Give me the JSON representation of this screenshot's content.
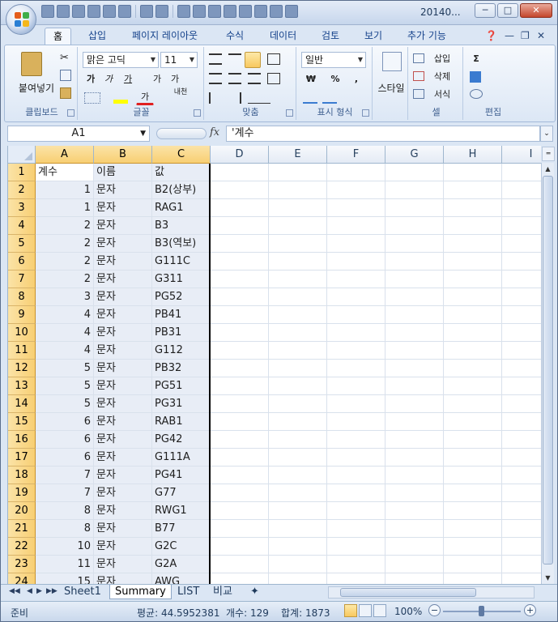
{
  "window": {
    "title": "20140...",
    "controls": [
      "─",
      "□",
      "✕"
    ]
  },
  "ribbon": {
    "tabs": [
      "홈",
      "삽입",
      "페이지 레이아웃",
      "수식",
      "데이터",
      "검토",
      "보기",
      "추가 기능"
    ],
    "active_tab": "홈",
    "groups": {
      "clipboard": {
        "label": "클립보드",
        "paste": "붙여넣기"
      },
      "font": {
        "label": "글꼴",
        "font_name": "맑은 고딕",
        "font_size": "11",
        "bold": "가",
        "italic": "가",
        "underline": "가",
        "grow": "가",
        "shrink": "가",
        "phonetic": "내천"
      },
      "align": {
        "label": "맞춤"
      },
      "number": {
        "label": "표시 형식",
        "format": "일반",
        "currency": "₩",
        "percent": "%",
        "comma": ","
      },
      "style": {
        "label": "스타일"
      },
      "cells": {
        "label": "셀",
        "insert": "삽입",
        "delete": "삭제",
        "format": "서식"
      },
      "editing": {
        "label": "편집",
        "sum": "Σ"
      }
    }
  },
  "formula_bar": {
    "name_box": "A1",
    "fx": "fx",
    "formula": "'계수"
  },
  "sheet": {
    "columns": [
      "A",
      "B",
      "C",
      "D",
      "E",
      "F",
      "G",
      "H",
      "I"
    ],
    "rows": [
      {
        "n": "1",
        "a": "계수",
        "b": "이름",
        "c": "값"
      },
      {
        "n": "2",
        "a": "1",
        "b": "문자",
        "c": "B2(상부)"
      },
      {
        "n": "3",
        "a": "1",
        "b": "문자",
        "c": "RAG1"
      },
      {
        "n": "4",
        "a": "2",
        "b": "문자",
        "c": "B3"
      },
      {
        "n": "5",
        "a": "2",
        "b": "문자",
        "c": "B3(역보)"
      },
      {
        "n": "6",
        "a": "2",
        "b": "문자",
        "c": "G111C"
      },
      {
        "n": "7",
        "a": "2",
        "b": "문자",
        "c": "G311"
      },
      {
        "n": "8",
        "a": "3",
        "b": "문자",
        "c": "PG52"
      },
      {
        "n": "9",
        "a": "4",
        "b": "문자",
        "c": "PB41"
      },
      {
        "n": "10",
        "a": "4",
        "b": "문자",
        "c": "PB31"
      },
      {
        "n": "11",
        "a": "4",
        "b": "문자",
        "c": "G112"
      },
      {
        "n": "12",
        "a": "5",
        "b": "문자",
        "c": "PB32"
      },
      {
        "n": "13",
        "a": "5",
        "b": "문자",
        "c": "PG51"
      },
      {
        "n": "14",
        "a": "5",
        "b": "문자",
        "c": "PG31"
      },
      {
        "n": "15",
        "a": "6",
        "b": "문자",
        "c": "RAB1"
      },
      {
        "n": "16",
        "a": "6",
        "b": "문자",
        "c": "PG42"
      },
      {
        "n": "17",
        "a": "6",
        "b": "문자",
        "c": "G111A"
      },
      {
        "n": "18",
        "a": "7",
        "b": "문자",
        "c": "PG41"
      },
      {
        "n": "19",
        "a": "7",
        "b": "문자",
        "c": "G77"
      },
      {
        "n": "20",
        "a": "8",
        "b": "문자",
        "c": "RWG1"
      },
      {
        "n": "21",
        "a": "8",
        "b": "문자",
        "c": "B77"
      },
      {
        "n": "22",
        "a": "10",
        "b": "문자",
        "c": "G2C"
      },
      {
        "n": "23",
        "a": "11",
        "b": "문자",
        "c": "G2A"
      },
      {
        "n": "24",
        "a": "15",
        "b": "문자",
        "c": "AWG"
      }
    ]
  },
  "sheet_tabs": [
    "Sheet1",
    "Summary",
    "LIST",
    "비교"
  ],
  "active_sheet": "Summary",
  "status": {
    "mode": "준비",
    "average": "평균: 44.5952381",
    "count": "개수: 129",
    "sum": "합계: 1873",
    "zoom": "100%"
  },
  "colors": {
    "header_selected": "#f8cf73",
    "ribbon_bg": "#dce7f5",
    "accent": "#15428b"
  }
}
